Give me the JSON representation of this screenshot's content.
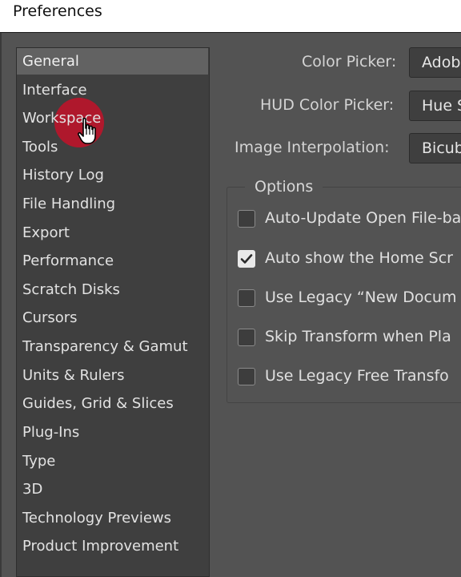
{
  "window": {
    "title": "Preferences"
  },
  "sidebar": {
    "items": [
      {
        "label": "General",
        "selected": true
      },
      {
        "label": "Interface",
        "selected": false
      },
      {
        "label": "Workspace",
        "selected": false
      },
      {
        "label": "Tools",
        "selected": false
      },
      {
        "label": "History Log",
        "selected": false
      },
      {
        "label": "File Handling",
        "selected": false
      },
      {
        "label": "Export",
        "selected": false
      },
      {
        "label": "Performance",
        "selected": false
      },
      {
        "label": "Scratch Disks",
        "selected": false
      },
      {
        "label": "Cursors",
        "selected": false
      },
      {
        "label": "Transparency & Gamut",
        "selected": false
      },
      {
        "label": "Units & Rulers",
        "selected": false
      },
      {
        "label": "Guides, Grid & Slices",
        "selected": false
      },
      {
        "label": "Plug-Ins",
        "selected": false
      },
      {
        "label": "Type",
        "selected": false
      },
      {
        "label": "3D",
        "selected": false
      },
      {
        "label": "Technology Previews",
        "selected": false
      },
      {
        "label": "Product Improvement",
        "selected": false
      }
    ]
  },
  "general": {
    "color_picker_label": "Color Picker:",
    "color_picker_value": "Adob",
    "hud_color_picker_label": "HUD Color Picker:",
    "hud_color_picker_value": "Hue S",
    "image_interpolation_label": "Image Interpolation:",
    "image_interpolation_value": "Bicub"
  },
  "options": {
    "legend": "Options",
    "checkboxes": [
      {
        "label": "Auto-Update Open File-ba",
        "checked": false
      },
      {
        "label": "Auto show the Home Scr",
        "checked": true
      },
      {
        "label": "Use Legacy “New Docum",
        "checked": false
      },
      {
        "label": "Skip Transform when Pla",
        "checked": false
      },
      {
        "label": "Use Legacy Free Transfo",
        "checked": false
      }
    ]
  },
  "colors": {
    "panel_background": "#535353",
    "sidebar_background": "#3f3f3f",
    "selected_item": "#626262",
    "click_highlight": "#c81028"
  },
  "cursor": {
    "icon": "hand-pointer-icon"
  }
}
